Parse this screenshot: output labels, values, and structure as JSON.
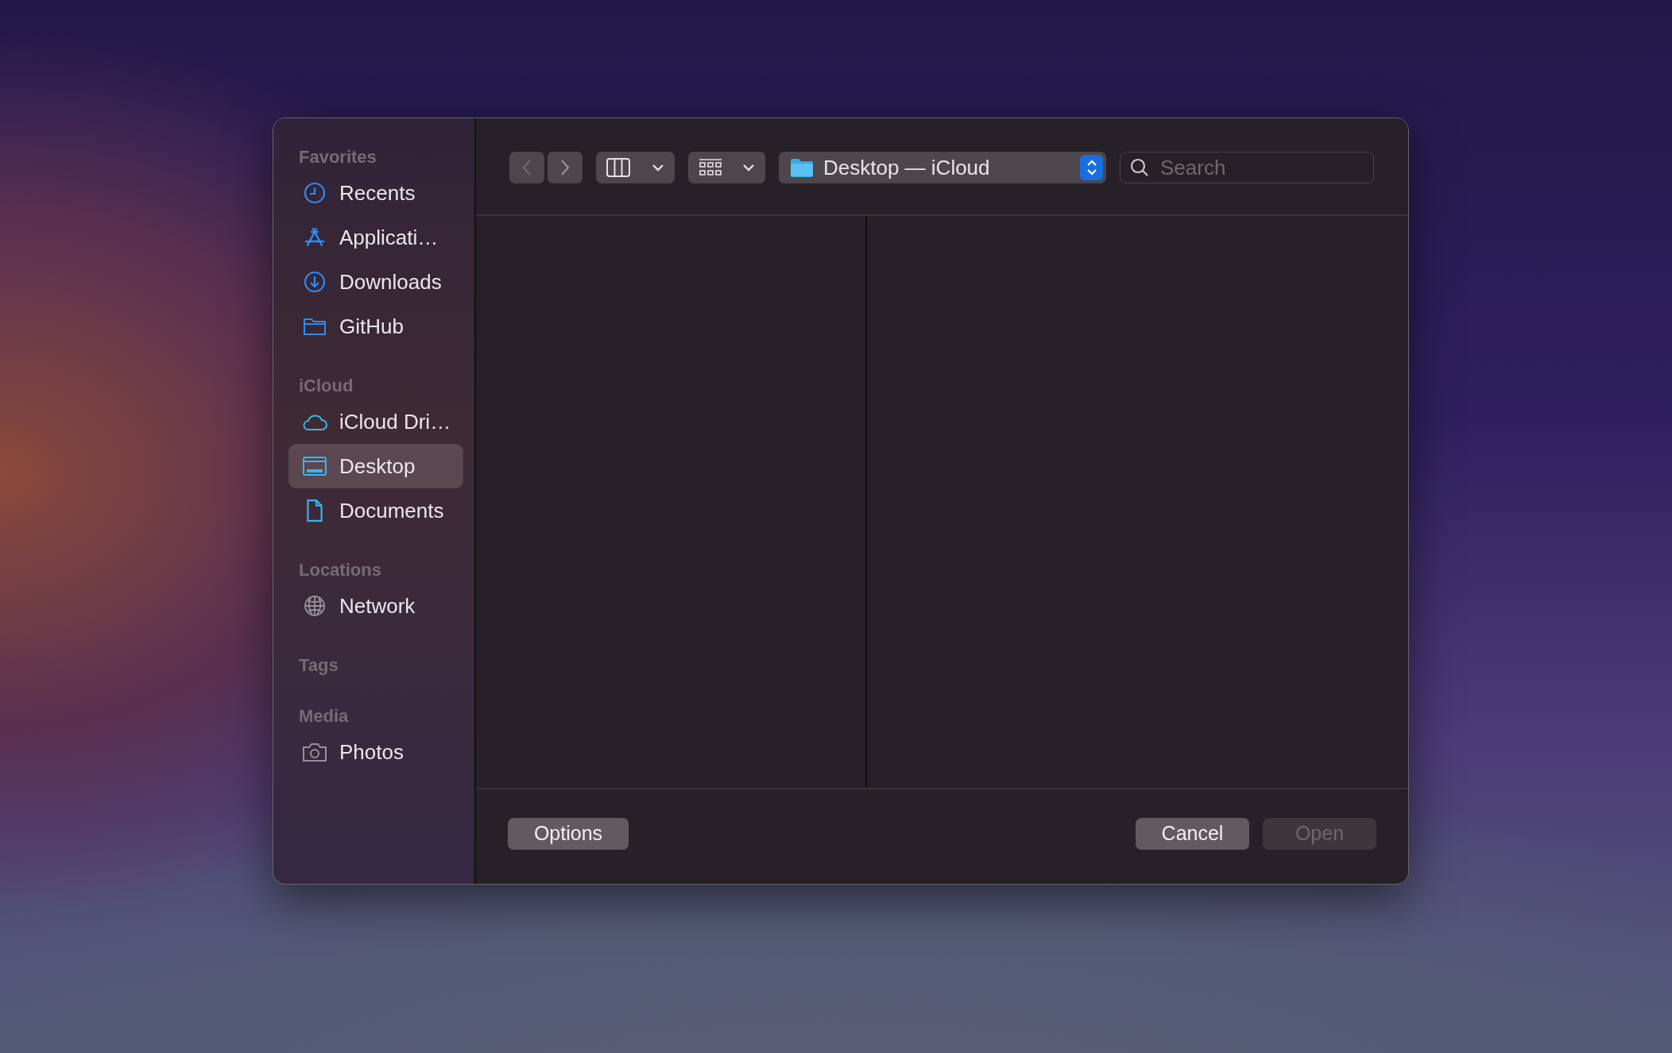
{
  "sidebar": {
    "sections": [
      {
        "title": "Favorites",
        "items": [
          {
            "label": "Recents",
            "kind": "recents",
            "selected": false
          },
          {
            "label": "Applicati…",
            "kind": "applications",
            "selected": false
          },
          {
            "label": "Downloads",
            "kind": "downloads",
            "selected": false
          },
          {
            "label": "GitHub",
            "kind": "folder",
            "selected": false
          }
        ]
      },
      {
        "title": "iCloud",
        "items": [
          {
            "label": "iCloud Dri…",
            "kind": "cloud",
            "selected": false
          },
          {
            "label": "Desktop",
            "kind": "desktop",
            "selected": true
          },
          {
            "label": "Documents",
            "kind": "document",
            "selected": false
          }
        ]
      },
      {
        "title": "Locations",
        "items": [
          {
            "label": "Network",
            "kind": "network",
            "selected": false
          }
        ]
      },
      {
        "title": "Tags"
      },
      {
        "title": "Media",
        "items": [
          {
            "label": "Photos",
            "kind": "photos",
            "selected": false
          }
        ]
      }
    ]
  },
  "toolbar": {
    "back": {
      "disabled": true
    },
    "forward": {
      "disabled": false
    },
    "path": "Desktop — iCloud",
    "search": {
      "placeholder": "Search"
    }
  },
  "buttons": [
    {
      "label": "Options",
      "disabled": false
    },
    {
      "label": "Cancel",
      "disabled": false
    },
    {
      "label": "Open",
      "disabled": true
    }
  ]
}
